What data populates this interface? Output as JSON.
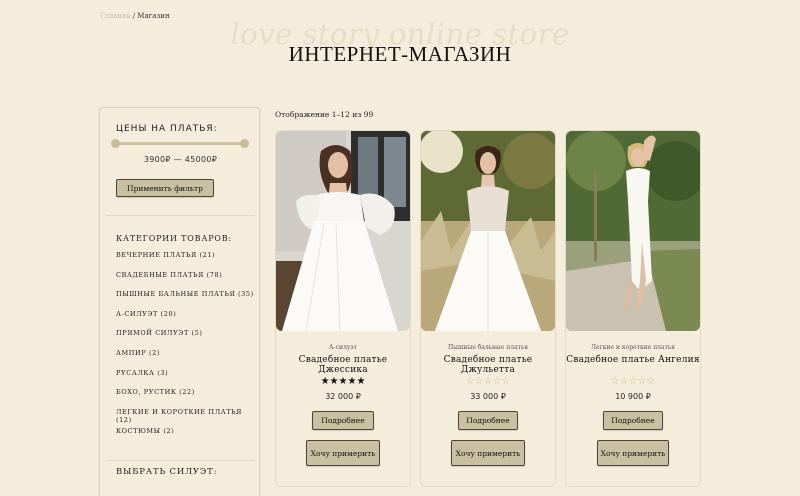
{
  "breadcrumb": {
    "home": "Главная",
    "separator": "/",
    "current": "Магазин"
  },
  "watermark": "love story online store",
  "page_title": "ИНТЕРНЕТ-МАГАЗИН",
  "sidebar": {
    "price_heading": "ЦЕНЫ НА ПЛАТЬЯ:",
    "price_range": "3900₽ — 45000₽",
    "price_slider": {
      "min": 0,
      "max": 1
    },
    "apply_filter": "Применить фильтр",
    "categories_heading": "КАТЕГОРИИ ТОВАРОВ:",
    "categories": [
      "ВЕЧЕРНИЕ ПЛАТЬЯ (21)",
      "СВАДЕБНЫЕ ПЛАТЬЯ (78)",
      "ПЫШНЫЕ БАЛЬНЫЕ ПЛАТЬЯ (35)",
      "А-СИЛУЭТ (20)",
      "ПРЯМОЙ СИЛУЭТ (5)",
      "АМПИР (2)",
      "РУСАЛКА (3)",
      "БОХО, РУСТИК (22)",
      "ЛЕГКИЕ И КОРОТКИЕ ПЛАТЬЯ (12)",
      "КОСТЮМЫ (2)"
    ],
    "silhouette_heading": "ВЫБРАТЬ СИЛУЭТ:"
  },
  "result_count": "Отображение 1–12 из 99",
  "products": [
    {
      "category": "А-силуэт",
      "name": "Свадебное платье Джессика",
      "rating": 5,
      "stars": "★★★★★",
      "price": "32 000 ₽",
      "details_label": "Подробнее",
      "try_label": "Хочу примерить"
    },
    {
      "category": "Пышные бальные платья",
      "name": "Свадебное платье Джульетта",
      "rating": 0,
      "stars": "☆☆☆☆☆",
      "price": "33 000 ₽",
      "details_label": "Подробнее",
      "try_label": "Хочу примерить"
    },
    {
      "category": "Легкие и короткие платья",
      "name": "Свадебное платье Ангелия",
      "rating": 0,
      "stars": "☆☆☆☆☆",
      "price": "10 900 ₽",
      "details_label": "Подробнее",
      "try_label": "Хочу примерить"
    }
  ],
  "colors": {
    "background": "#f4eddb",
    "button": "#c9c0a2",
    "slider": "#cfc3a1",
    "empty_star": "#c6b98e"
  }
}
